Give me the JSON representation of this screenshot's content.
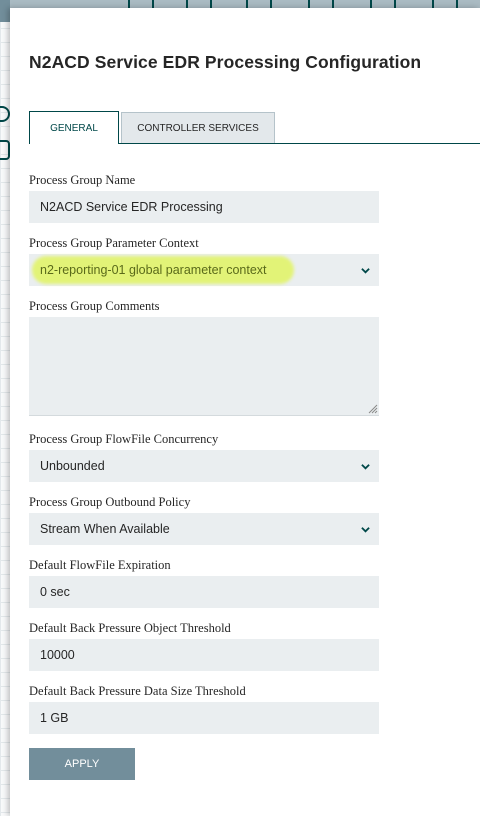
{
  "dialog": {
    "title": "N2ACD Service EDR Processing Configuration"
  },
  "tabs": [
    {
      "label": "GENERAL",
      "active": true
    },
    {
      "label": "CONTROLLER SERVICES",
      "active": false
    }
  ],
  "form": {
    "name": {
      "label": "Process Group Name",
      "value": "N2ACD Service EDR Processing"
    },
    "parameter_context": {
      "label": "Process Group Parameter Context",
      "value": "n2-reporting-01 global parameter context",
      "highlighted": true
    },
    "comments": {
      "label": "Process Group Comments",
      "value": ""
    },
    "concurrency": {
      "label": "Process Group FlowFile Concurrency",
      "value": "Unbounded"
    },
    "outbound_policy": {
      "label": "Process Group Outbound Policy",
      "value": "Stream When Available"
    },
    "expiration": {
      "label": "Default FlowFile Expiration",
      "value": "0 sec"
    },
    "bp_object": {
      "label": "Default Back Pressure Object Threshold",
      "value": "10000"
    },
    "bp_size": {
      "label": "Default Back Pressure Data Size Threshold",
      "value": "1 GB"
    }
  },
  "apply_label": "APPLY",
  "colors": {
    "accent": "#004849",
    "button": "#728e9b",
    "input_bg": "#eaeef0",
    "highlight": "#e2f46a"
  },
  "icons": {
    "select_chevron": "chevron-down-icon",
    "textarea_grip": "resize-grip-icon"
  }
}
